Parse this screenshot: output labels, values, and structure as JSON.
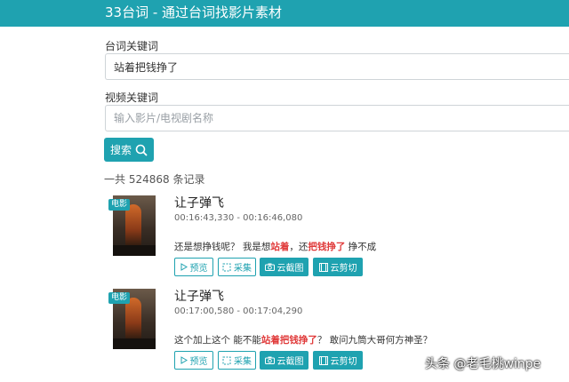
{
  "header": {
    "title": "33台词 - 通过台词找影片素材"
  },
  "form": {
    "line_label": "台词关键词",
    "line_value": "站着把钱挣了",
    "video_label": "视频关键词",
    "video_placeholder": "输入影片/电视剧名称",
    "search_label": "搜索"
  },
  "results": {
    "count_text": "一共 524868 条记录",
    "items": [
      {
        "badge": "电影",
        "title": "让子弹飞",
        "time": "00:16:43,330 - 00:16:46,080",
        "quote_parts": [
          "还是想挣钱呢？ 我是想",
          "站着",
          "，还",
          "把钱挣了",
          " 挣不成"
        ],
        "buttons": {
          "preview": "预览",
          "collect": "采集",
          "screenshot": "云截图",
          "clip": "云剪切"
        }
      },
      {
        "badge": "电影",
        "title": "让子弹飞",
        "time": "00:17:00,580 - 00:17:04,290",
        "quote_parts": [
          "这个加上这个 能不能",
          "站着把钱挣了",
          "？ 敢问九筒大哥何方神圣？"
        ],
        "buttons": {
          "preview": "预览",
          "collect": "采集",
          "screenshot": "云截图",
          "clip": "云剪切"
        }
      }
    ]
  },
  "watermark": "头条 @老毛桃winpe",
  "colors": {
    "accent": "#1fa2b0",
    "highlight": "#e03a3a"
  }
}
